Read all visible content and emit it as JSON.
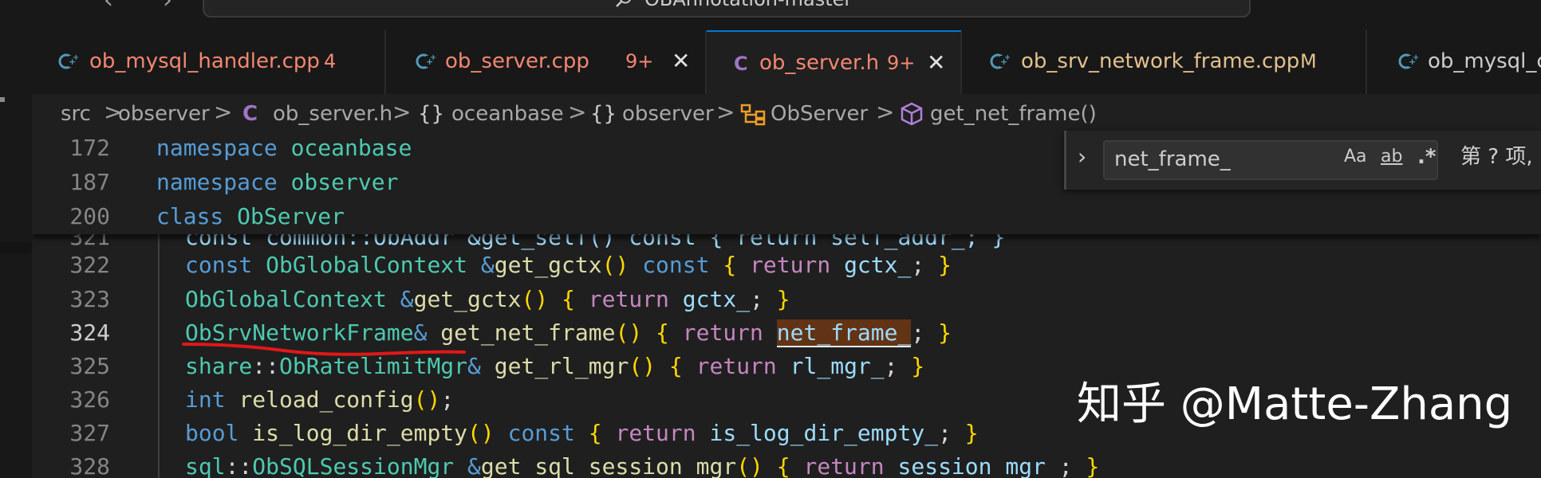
{
  "title_bar": {
    "back_arrow": "‹",
    "forward_arrow": "›",
    "search_text": "OBAnnotation-master"
  },
  "tabs": [
    {
      "name": "ob_mysql_handler.cpp",
      "badge": "4",
      "icon": "cpp-file-icon",
      "color": "#f48771",
      "badge_color": "#f48771",
      "active": false
    },
    {
      "name": "ob_server.cpp",
      "badge": "9+",
      "icon": "cpp-file-icon",
      "color": "#f48771",
      "badge_color": "#f48771",
      "active": false,
      "close": "✕"
    },
    {
      "name": "ob_server.h",
      "badge": "9+",
      "icon": "header-file-icon",
      "color": "#f48771",
      "badge_color": "#f48771",
      "active": true,
      "close": "✕"
    },
    {
      "name": "ob_srv_network_frame.cpp",
      "badge": "M",
      "icon": "cpp-file-icon",
      "color": "#e2c08d",
      "badge_color": "#e2c08d",
      "active": false
    },
    {
      "name": "ob_mysql_conn",
      "badge": "",
      "icon": "cpp-file-icon",
      "color": "#cccccc",
      "badge_color": "#cccccc",
      "active": false
    }
  ],
  "breadcrumb": {
    "items": [
      "src",
      "observer",
      "ob_server.h",
      "oceanbase",
      "observer",
      "ObServer",
      "get_net_frame()"
    ],
    "separator": ">",
    "namespace_glyph": "{}",
    "header_glyph": "C"
  },
  "sticky_scroll": [
    {
      "line": "172",
      "keyword": "namespace",
      "name": "oceanbase"
    },
    {
      "line": "187",
      "keyword": "namespace",
      "name": "observer"
    },
    {
      "line": "200",
      "keyword": "class",
      "name": "ObServer"
    }
  ],
  "partial_line": "const common::ObAddr &get_self() const { return self_addr_; }",
  "line_numbers": [
    "321",
    "322",
    "323",
    "324",
    "325",
    "326",
    "327",
    "328"
  ],
  "current_line": "324",
  "code": {
    "l322": [
      "const",
      "ObGlobalContext",
      "&",
      "get_gctx",
      "(",
      ")",
      "const",
      "{",
      "return",
      "gctx_",
      ";",
      "}"
    ],
    "l323": [
      "ObGlobalContext",
      "&",
      "get_gctx",
      "(",
      ")",
      "{",
      "return",
      "gctx_",
      ";",
      "}"
    ],
    "l324": [
      "ObSrvNetworkFrame",
      "&",
      "get_net_frame",
      "(",
      ")",
      "{",
      "return",
      "net_frame_",
      ";",
      "}"
    ],
    "l325": [
      "share",
      "::",
      "ObRatelimitMgr",
      "&",
      "get_rl_mgr",
      "(",
      ")",
      "{",
      "return",
      "rl_mgr_",
      ";",
      "}"
    ],
    "l326": [
      "int",
      "reload_config",
      "(",
      ")",
      ";"
    ],
    "l327": [
      "bool",
      "is_log_dir_empty",
      "(",
      ")",
      "const",
      "{",
      "return",
      "is_log_dir_empty_",
      ";",
      "}"
    ],
    "l328": [
      "sql",
      "::",
      "ObSQLSessionMgr",
      "&",
      "get_sql_session_mgr",
      "(",
      ")",
      "{",
      "return",
      "session_mgr_",
      ";",
      "}"
    ]
  },
  "find_widget": {
    "expand_glyph": "›",
    "query": "net_frame_",
    "match_case": "Aa",
    "whole_word": "ab",
    "regex": ".*",
    "result": "第 ? 项,"
  },
  "watermark": "知乎 @Matte-Zhang",
  "colors": {
    "tab_active_border": "#0078d4",
    "keyword": "#569cd6",
    "control": "#c586c0",
    "type": "#4ec9b0",
    "function": "#dcdcaa",
    "variable": "#9cdcfe",
    "match_highlight": "#623315",
    "annotation": "#e01818"
  }
}
